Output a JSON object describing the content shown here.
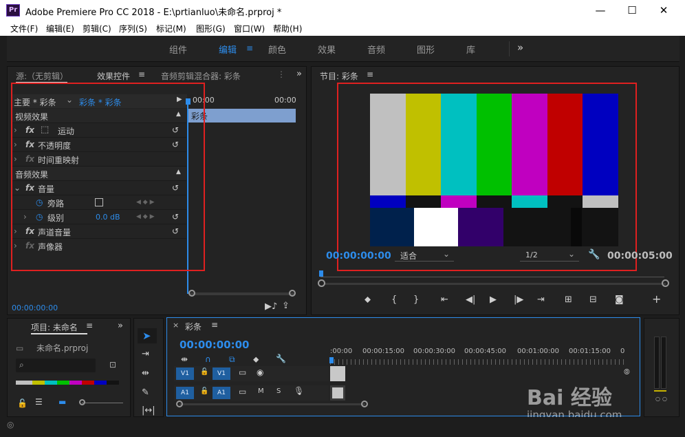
{
  "window": {
    "logo_text": "Pr",
    "title": "Adobe Premiere Pro CC 2018 - E:\\prtianluo\\未命名.prproj *",
    "minimize": "—",
    "maximize": "☐",
    "close": "✕"
  },
  "menu": [
    "文件(F)",
    "编辑(E)",
    "剪辑(C)",
    "序列(S)",
    "标记(M)",
    "图形(G)",
    "窗口(W)",
    "帮助(H)"
  ],
  "workspaces": {
    "items": [
      "组件",
      "编辑",
      "颜色",
      "效果",
      "音频",
      "图形",
      "库"
    ],
    "active": "编辑",
    "more": "»"
  },
  "source_panel": {
    "tab_source": "源:（无剪辑）",
    "tab_effects": "效果控件",
    "tab_audio_mixer": "音频剪辑混合器: 彩条",
    "master_label": "主要 * 彩条",
    "clip_label": "彩条 * 彩条",
    "timecode_left": "00:00",
    "timecode_right": "00:00",
    "clip_bar_label": "彩条",
    "video_effects_header": "视频效果",
    "video_effects": [
      "运动",
      "不透明度",
      "时间重映射"
    ],
    "audio_effects_header": "音频效果",
    "volume": "音量",
    "bypass": "旁路",
    "level_label": "级别",
    "level_value": "0.0 dB",
    "channel_volume": "声道音量",
    "panner": "声像器",
    "bottom_timecode": "00:00:00:00"
  },
  "program_monitor": {
    "title": "节目: 彩条",
    "timecode_current": "00:00:00:00",
    "fit": "适合",
    "resolution": "1/2",
    "timecode_duration": "00:00:05:00",
    "colors": {
      "top_bars": [
        "#c0c0c0",
        "#c0c000",
        "#00c0c0",
        "#00c000",
        "#c000c0",
        "#c00000",
        "#0000c0"
      ],
      "mid_bars": [
        "#0000c0",
        "#131313",
        "#c000c0",
        "#131313",
        "#00c0c0",
        "#131313",
        "#c0c0c0"
      ],
      "bottom_bars": [
        "#00214c",
        "#ffffff",
        "#32006a",
        "#131313",
        "#131313",
        "#090909",
        "#131313"
      ]
    }
  },
  "project_panel": {
    "title": "项目: 未命名",
    "file": "未命名.prproj"
  },
  "timeline": {
    "title": "彩条",
    "timecode": "00:00:00:00",
    "ruler": [
      ":00:00",
      "00:00:15:00",
      "00:00:30:00",
      "00:00:45:00",
      "00:01:00:00",
      "00:01:15:00",
      "0"
    ],
    "tracks": [
      {
        "label": "V1",
        "target": "V1"
      },
      {
        "label": "A1",
        "target": "A1"
      }
    ],
    "mute": "M",
    "solo": "S"
  },
  "watermark": {
    "brand": "Bai 经验",
    "url": "jingyan.baidu.com"
  }
}
